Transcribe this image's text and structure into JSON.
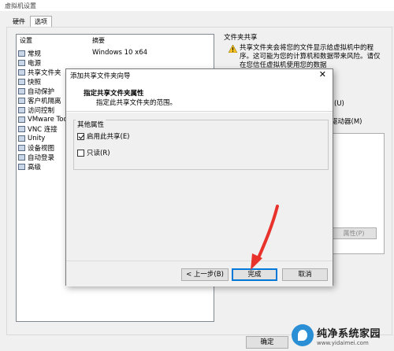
{
  "window": {
    "title": "虚拟机设置"
  },
  "tabs": [
    {
      "label": "硬件"
    },
    {
      "label": "选项"
    }
  ],
  "settings_list": {
    "headers": {
      "setting": "设置",
      "summary": "摘要"
    },
    "summary_value": "Windows 10 x64",
    "items": [
      {
        "label": "常规"
      },
      {
        "label": "电源"
      },
      {
        "label": "共享文件夹"
      },
      {
        "label": "快照"
      },
      {
        "label": "自动保护"
      },
      {
        "label": "客户机隔离"
      },
      {
        "label": "访问控制"
      },
      {
        "label": "VMware Too"
      },
      {
        "label": "VNC 连接"
      },
      {
        "label": "Unity"
      },
      {
        "label": "设备视图"
      },
      {
        "label": "自动登录"
      },
      {
        "label": "高级"
      }
    ]
  },
  "right_panel": {
    "title": "文件夹共享",
    "warning": "共享文件夹会将您的文件显示给虚拟机中的程序。这可能为您的计算机和数据带来风险。请仅在您信任虚拟机使用您的数据",
    "fragment1": "(U)",
    "fragment2": "驱动器(M)",
    "properties_button": "属性(P)"
  },
  "footer": {
    "ok_button": "确定"
  },
  "dialog": {
    "title": "添加共享文件夹向导",
    "heading": "指定共享文件夹属性",
    "subheading": "指定此共享文件夹的范围。",
    "group_label": "其他属性",
    "checkbox_enable": {
      "label": "启用此共享(E)",
      "checked": true
    },
    "checkbox_readonly": {
      "label": "只读(R)",
      "checked": false
    },
    "back_button": "< 上一步(B)",
    "finish_button": "完成",
    "cancel_button": "取消"
  },
  "watermark": {
    "line1": "纯净系统家园",
    "line2": "www.yidaimei.com"
  },
  "colors": {
    "accent": "#0078d7",
    "arrow": "#e8322b"
  }
}
